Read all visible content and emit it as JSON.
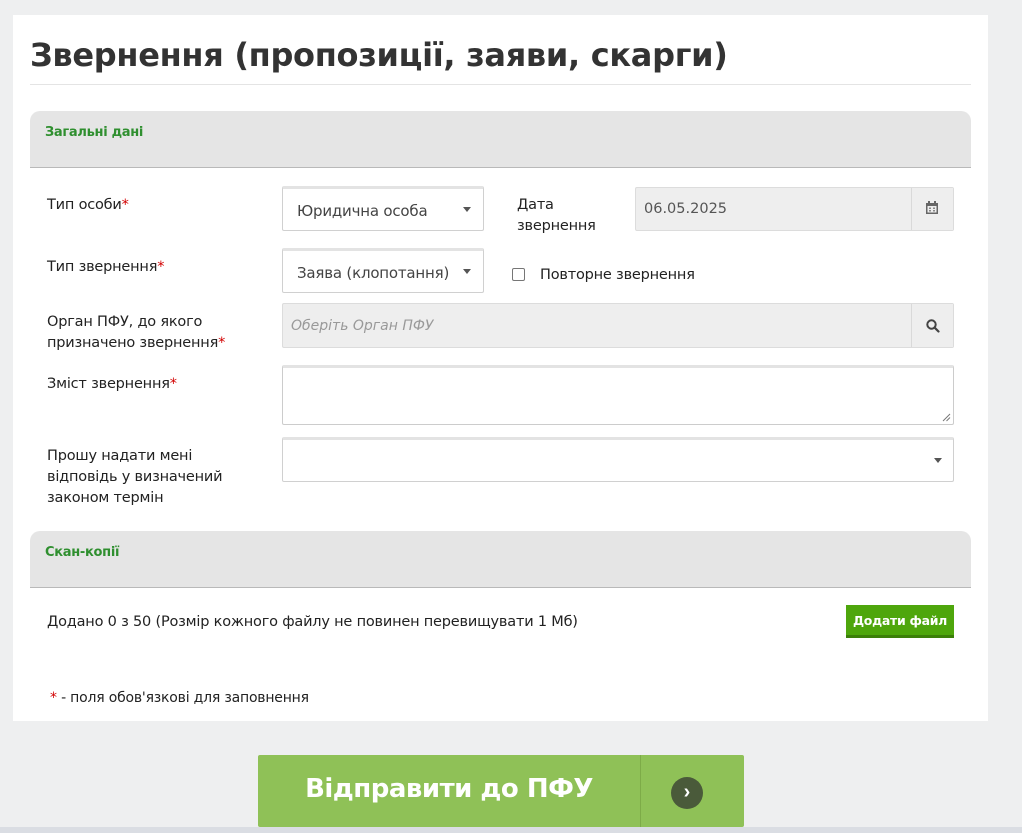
{
  "page_title": "Звернення (пропозиції, заяви, скарги)",
  "sections": {
    "general": "Загальні дані",
    "scans": "Скан-копії"
  },
  "fields": {
    "person_type_label": "Тип особи",
    "person_type_value": "Юридична особа",
    "date_label_1": "Дата",
    "date_label_2": "звернення",
    "date_value": "06.05.2025",
    "appeal_type_label": "Тип звернення",
    "appeal_type_value": "Заява (клопотання)",
    "repeat_label": "Повторне звернення",
    "organ_label_1": "Орган ПФУ, до якого",
    "organ_label_2": "призначено звернення",
    "organ_placeholder": "Оберіть Орган ПФУ",
    "content_label": "Зміст звернення",
    "response_label_1": "Прошу надати мені",
    "response_label_2": "відповідь у визначений",
    "response_label_3": "законом термін",
    "response_value": "",
    "required_mark": "*"
  },
  "files": {
    "count_text": "Додано 0 з 50 (Розмір кожного файлу не повинен перевищувати 1 Мб)",
    "add_button": "Додати файл"
  },
  "footnote": {
    "mark": "*",
    "text": "- поля обов'язкові для заповнення"
  },
  "submit": {
    "label": "Відправити до ПФУ",
    "arrow": "›"
  },
  "icons": {
    "calendar": "calendar-icon",
    "search": "search-icon"
  },
  "colors": {
    "section_text": "#2f8f2f",
    "add_button": "#4ea60c",
    "submit_button": "#8fc157",
    "required": "#d20000"
  }
}
